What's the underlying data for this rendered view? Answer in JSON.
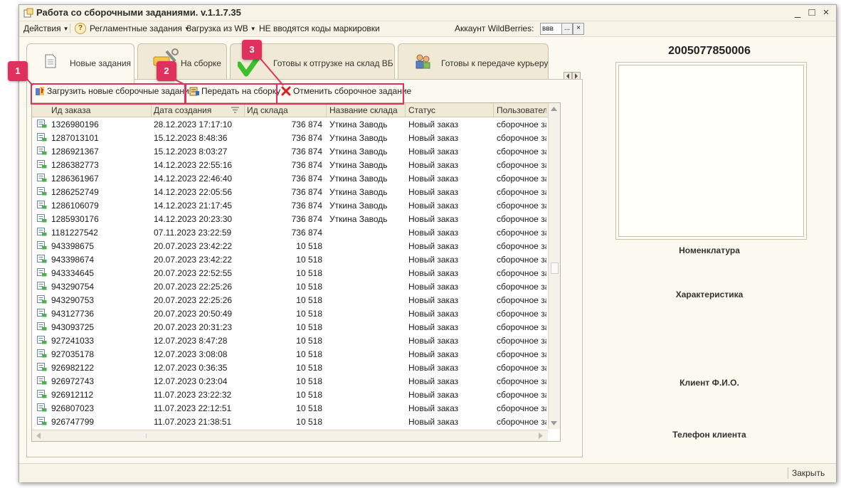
{
  "window": {
    "title": "Работа со сборочными заданиями. v.1.1.7.35",
    "controls": {
      "minimize": "_",
      "maximize": "□",
      "close": "×"
    }
  },
  "menu": {
    "actions": "Действия",
    "scheduled": "Регламентные задания",
    "load_wb": "Загрузка из WB",
    "marking": "НЕ вводятся коды маркировки",
    "account_label": "Аккаунт WildBerries:",
    "account_value": "ввв",
    "account_pick": "...",
    "account_clear": "×"
  },
  "tabs": [
    {
      "label": "Новые задания",
      "icon": "document-icon",
      "active": true
    },
    {
      "label": "На сборке",
      "icon": "tools-icon",
      "active": false
    },
    {
      "label": "Готовы к отгрузке на склад ВБ",
      "icon": "checkmark-icon",
      "active": false
    },
    {
      "label": "Готовы к передаче курьеру",
      "icon": "courier-icon",
      "active": false
    }
  ],
  "actions": {
    "load_new": "Загрузить новые сборочные задания",
    "transfer": "Передать на сборку",
    "cancel": "Отменить сборочное задание"
  },
  "callouts": [
    "1",
    "2",
    "3"
  ],
  "table": {
    "columns": [
      "Ид заказа",
      "Дата создания",
      "Ид склада",
      "Название склада",
      "Статус",
      "Пользователь"
    ],
    "rows": [
      [
        "1326980196",
        "28.12.2023 17:17:10",
        "736 874",
        "Уткина Заводь",
        "Новый заказ",
        "сборочное зад"
      ],
      [
        "1287013101",
        "15.12.2023 8:48:36",
        "736 874",
        "Уткина Заводь",
        "Новый заказ",
        "сборочное зад"
      ],
      [
        "1286921367",
        "15.12.2023 8:03:27",
        "736 874",
        "Уткина Заводь",
        "Новый заказ",
        "сборочное зад"
      ],
      [
        "1286382773",
        "14.12.2023 22:55:16",
        "736 874",
        "Уткина Заводь",
        "Новый заказ",
        "сборочное зад"
      ],
      [
        "1286361967",
        "14.12.2023 22:46:40",
        "736 874",
        "Уткина Заводь",
        "Новый заказ",
        "сборочное зад"
      ],
      [
        "1286252749",
        "14.12.2023 22:05:56",
        "736 874",
        "Уткина Заводь",
        "Новый заказ",
        "сборочное зад"
      ],
      [
        "1286106079",
        "14.12.2023 21:17:45",
        "736 874",
        "Уткина Заводь",
        "Новый заказ",
        "сборочное зад"
      ],
      [
        "1285930176",
        "14.12.2023 20:23:30",
        "736 874",
        "Уткина Заводь",
        "Новый заказ",
        "сборочное зад"
      ],
      [
        "1181227542",
        "07.11.2023 23:22:59",
        "736 874",
        "",
        "Новый заказ",
        "сборочное зад"
      ],
      [
        "943398675",
        "20.07.2023 23:42:22",
        "10 518",
        "",
        "Новый заказ",
        "сборочное зад"
      ],
      [
        "943398674",
        "20.07.2023 23:42:22",
        "10 518",
        "",
        "Новый заказ",
        "сборочное зад"
      ],
      [
        "943334645",
        "20.07.2023 22:52:55",
        "10 518",
        "",
        "Новый заказ",
        "сборочное зад"
      ],
      [
        "943290754",
        "20.07.2023 22:25:26",
        "10 518",
        "",
        "Новый заказ",
        "сборочное зад"
      ],
      [
        "943290753",
        "20.07.2023 22:25:26",
        "10 518",
        "",
        "Новый заказ",
        "сборочное зад"
      ],
      [
        "943127736",
        "20.07.2023 20:50:49",
        "10 518",
        "",
        "Новый заказ",
        "сборочное зад"
      ],
      [
        "943093725",
        "20.07.2023 20:31:23",
        "10 518",
        "",
        "Новый заказ",
        "сборочное зад"
      ],
      [
        "927241033",
        "12.07.2023 8:47:28",
        "10 518",
        "",
        "Новый заказ",
        "сборочное зад"
      ],
      [
        "927035178",
        "12.07.2023 3:08:08",
        "10 518",
        "",
        "Новый заказ",
        "сборочное зад"
      ],
      [
        "926982122",
        "12.07.2023 0:36:35",
        "10 518",
        "",
        "Новый заказ",
        "сборочное зад"
      ],
      [
        "926972743",
        "12.07.2023 0:23:04",
        "10 518",
        "",
        "Новый заказ",
        "сборочное зад"
      ],
      [
        "926912112",
        "11.07.2023 23:22:32",
        "10 518",
        "",
        "Новый заказ",
        "сборочное зад"
      ],
      [
        "926807023",
        "11.07.2023 22:12:51",
        "10 518",
        "",
        "Новый заказ",
        "сборочное зад"
      ],
      [
        "926747799",
        "11.07.2023 21:38:51",
        "10 518",
        "",
        "Новый заказ",
        "сборочное зад"
      ]
    ]
  },
  "right_panel": {
    "barcode": "2005077850006",
    "nomenclature": "Номенклатура",
    "characteristic": "Характеристика",
    "client_name": "Клиент Ф.И.О.",
    "client_phone": "Телефон клиента"
  },
  "footer": {
    "close": "Закрыть"
  },
  "colors": {
    "accent": "#e0315e",
    "background": "#fcf9f0",
    "tab": "#efe9d5"
  }
}
